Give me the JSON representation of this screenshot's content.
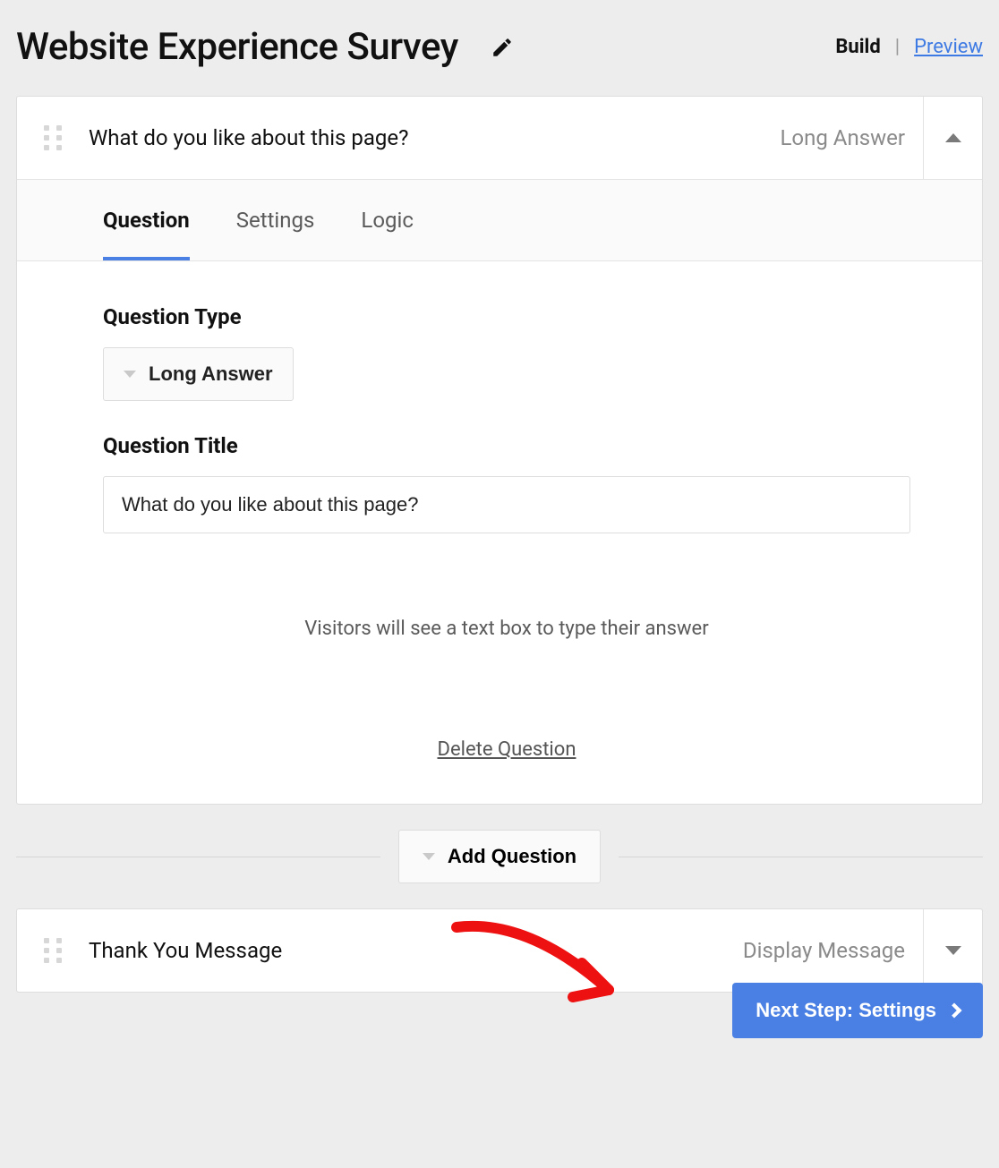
{
  "header": {
    "title": "Website Experience Survey",
    "build_label": "Build",
    "preview_label": "Preview",
    "separator": "|"
  },
  "question1": {
    "title": "What do you like about this page?",
    "type_label": "Long Answer",
    "tabs": {
      "question": "Question",
      "settings": "Settings",
      "logic": "Logic"
    },
    "field_type_label": "Question Type",
    "type_dropdown_value": "Long Answer",
    "field_title_label": "Question Title",
    "title_input_value": "What do you like about this page?",
    "helper_text": "Visitors will see a text box to type their answer",
    "delete_label": "Delete Question"
  },
  "add_question_label": "Add Question",
  "thank_you": {
    "title": "Thank You Message",
    "type_label": "Display Message"
  },
  "next_button_label": "Next Step: Settings"
}
